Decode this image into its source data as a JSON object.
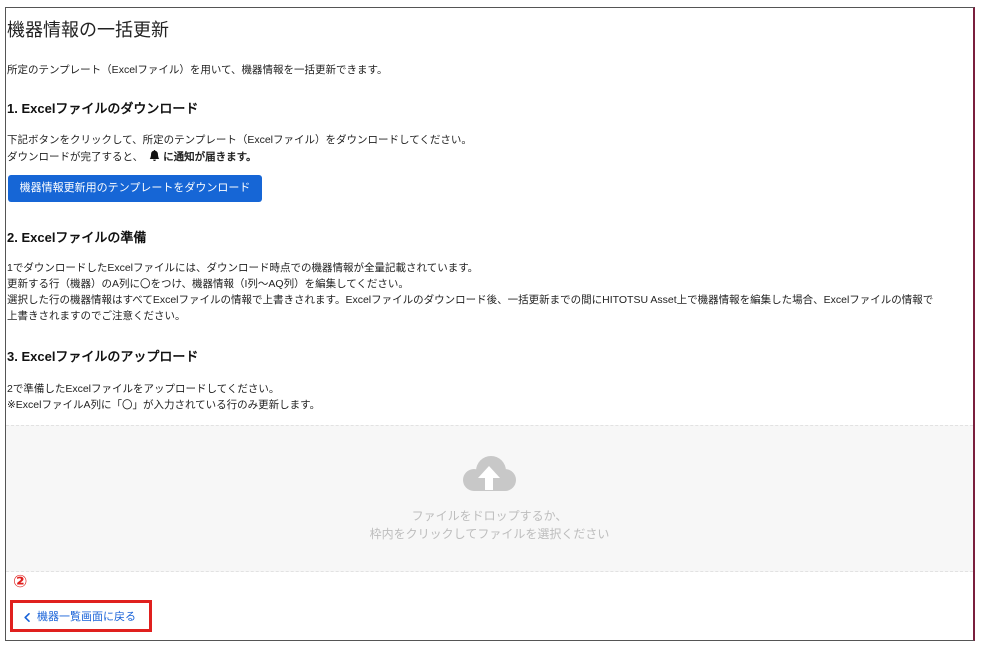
{
  "page": {
    "title": "機器情報の一括更新",
    "description": "所定のテンプレート（Excelファイル）を用いて、機器情報を一括更新できます。"
  },
  "download_section": {
    "heading": "1. Excelファイルのダウンロード",
    "instruction": "下記ボタンをクリックして、所定のテンプレート（Excelファイル）をダウンロードしてください。",
    "notice_prefix": "ダウンロードが完了すると、",
    "notice_icon": "bell-icon",
    "notice_suffix": "に通知が届きます。",
    "button_label": "機器情報更新用のテンプレートをダウンロード"
  },
  "prepare_section": {
    "heading": "2. Excelファイルの準備",
    "lines": [
      "1でダウンロードしたExcelファイルには、ダウンロード時点での機器情報が全量記載されています。",
      "更新する行（機器）のA列に〇をつけ、機器情報（I列～AQ列）を編集してください。",
      "選択した行の機器情報はすべてExcelファイルの情報で上書きされます。Excelファイルのダウンロード後、一括更新までの間にHITOTSU Asset上で機器情報を編集した場合、Excelファイルの情報で",
      "上書きされますのでご注意ください。"
    ]
  },
  "upload_section": {
    "heading": "3. Excelファイルのアップロード",
    "lines": [
      "2で準備したExcelファイルをアップロードしてください。",
      "※ExcelファイルA列に「〇」が入力されている行のみ更新します。"
    ]
  },
  "dropzone": {
    "icon": "cloud-upload-icon",
    "hint_lines": [
      "ファイルをドロップするか、",
      "枠内をクリックしてファイルを選択ください"
    ]
  },
  "annotation": {
    "marker": "②"
  },
  "back_link": {
    "icon": "chevron-left-icon",
    "label": "機器一覧画面に戻る"
  },
  "colors": {
    "primary": "#1666d6",
    "link": "#1a63d8",
    "annotation_red": "#e0201e",
    "dropzone_bg": "#f7f7f7",
    "dropzone_text": "#bdbdbd",
    "frame_right_border": "#7a1f3d"
  }
}
